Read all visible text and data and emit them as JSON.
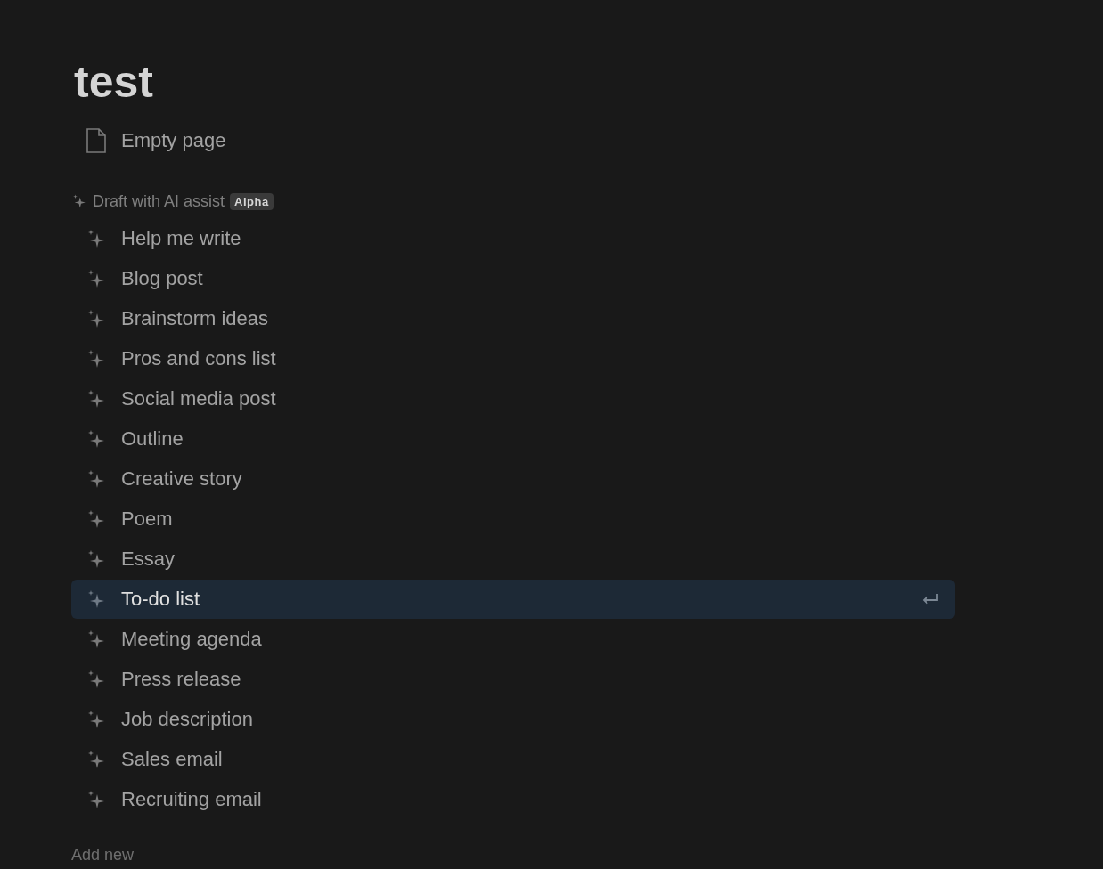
{
  "title": "test",
  "empty_page": {
    "label": "Empty page"
  },
  "ai_section": {
    "heading": "Draft with AI assist",
    "badge": "Alpha"
  },
  "items": [
    {
      "label": "Help me write",
      "selected": false
    },
    {
      "label": "Blog post",
      "selected": false
    },
    {
      "label": "Brainstorm ideas",
      "selected": false
    },
    {
      "label": "Pros and cons list",
      "selected": false
    },
    {
      "label": "Social media post",
      "selected": false
    },
    {
      "label": "Outline",
      "selected": false
    },
    {
      "label": "Creative story",
      "selected": false
    },
    {
      "label": "Poem",
      "selected": false
    },
    {
      "label": "Essay",
      "selected": false
    },
    {
      "label": "To-do list",
      "selected": true
    },
    {
      "label": "Meeting agenda",
      "selected": false
    },
    {
      "label": "Press release",
      "selected": false
    },
    {
      "label": "Job description",
      "selected": false
    },
    {
      "label": "Sales email",
      "selected": false
    },
    {
      "label": "Recruiting email",
      "selected": false
    }
  ],
  "add_new": "Add new"
}
